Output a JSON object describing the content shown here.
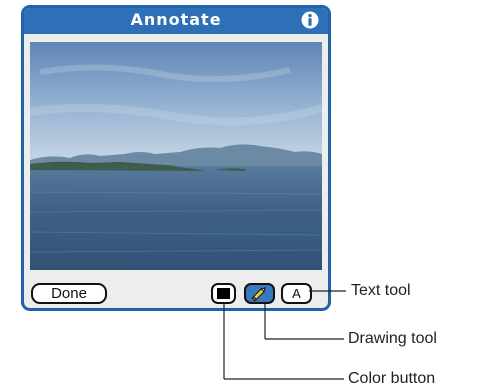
{
  "window": {
    "title": "Annotate",
    "info_icon": "info-icon"
  },
  "photo": {
    "description_icon": "photo-landscape"
  },
  "toolbar": {
    "done_label": "Done",
    "color_button_color": "#000000",
    "drawing_tool_icon": "pencil-icon",
    "text_tool_label": "A"
  },
  "callouts": {
    "text_tool": "Text tool",
    "drawing_tool": "Drawing tool",
    "color_button": "Color button"
  },
  "colors": {
    "accent": "#2e70b8",
    "frame": "#1f63a8",
    "drawing_active": "#3a78c0"
  }
}
